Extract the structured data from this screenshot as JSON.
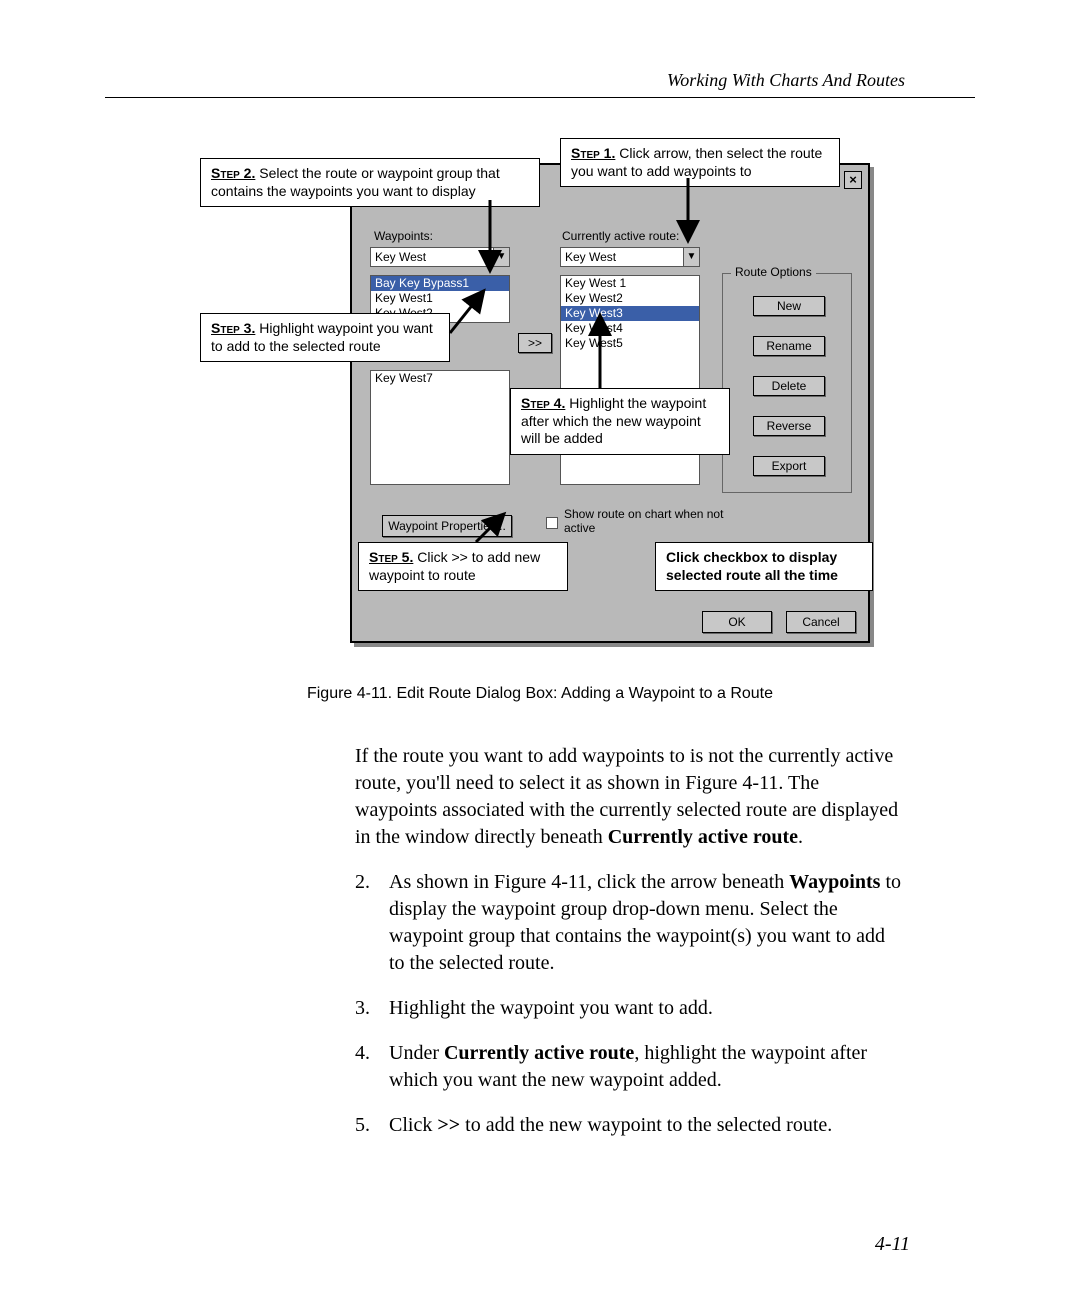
{
  "header": {
    "running": "Working With Charts And Routes"
  },
  "dialog": {
    "close": "×",
    "waypoints_label": "Waypoints:",
    "route_label": "Currently active route:",
    "waypoints_combo": "Key West",
    "route_combo": "Key West",
    "waypoint_list": [
      {
        "text": "Bay Key Bypass1",
        "sel": true
      },
      {
        "text": "Key West1",
        "sel": false
      },
      {
        "text": "Key West2",
        "sel": false
      }
    ],
    "route_list": [
      {
        "text": "Key West 1",
        "sel": false
      },
      {
        "text": "Key West2",
        "sel": false
      },
      {
        "text": "Key West3",
        "sel": true
      },
      {
        "text": "Key West4",
        "sel": false
      },
      {
        "text": "Key West5",
        "sel": false
      }
    ],
    "lower_list": [
      {
        "text": "Key West7",
        "sel": false
      }
    ],
    "add_btn": ">>",
    "wp_props_btn": "Waypoint Properties...",
    "group_label": "Route Options",
    "btn_new": "New",
    "btn_rename": "Rename",
    "btn_delete": "Delete",
    "btn_reverse": "Reverse",
    "btn_export": "Export",
    "show_route_label": "Show route on chart when not active",
    "ok": "OK",
    "cancel": "Cancel"
  },
  "callouts": {
    "step1": {
      "step": "Step 1.",
      "text": "  Click arrow, then select the route you want to add waypoints to"
    },
    "step2": {
      "step": "Step 2.",
      "text": "  Select the route or waypoint group that contains the waypoints you want to display"
    },
    "step3": {
      "step": "Step 3.",
      "text": "  Highlight waypoint you want to add to the selected route"
    },
    "step4": {
      "step": "Step 4.",
      "text": "  Highlight the waypoint after which the new waypoint will be added"
    },
    "step5": {
      "step": "Step 5.",
      "text": "  Click >> to add new waypoint to route"
    },
    "chk": {
      "text": "Click checkbox to display selected route all the time"
    }
  },
  "figure_caption": "Figure 4-11.  Edit Route Dialog Box:  Adding a Waypoint to a Route",
  "body": {
    "intro": "If the route you want to add waypoints to is not the currently active route, you'll need to select it as shown in Figure 4-11.  The waypoints associated with the currently selected route are displayed in the window directly beneath ",
    "intro_bold": "Currently active route",
    "intro_after": ".",
    "li2_a": "As shown in Figure 4-11, click the arrow beneath ",
    "li2_bold": "Waypoints",
    "li2_b": " to display the waypoint group drop-down menu.  Select the waypoint group that contains the waypoint(s) you want to add to the selected route.",
    "li3": "Highlight the waypoint you want to add.",
    "li4_a": "Under ",
    "li4_bold": "Currently active route",
    "li4_b": ", highlight the waypoint after which you want the new waypoint added.",
    "li5_a": "Click ",
    "li5_bold": ">>",
    "li5_b": " to add the new waypoint to the selected route."
  },
  "page_number": "4-11"
}
